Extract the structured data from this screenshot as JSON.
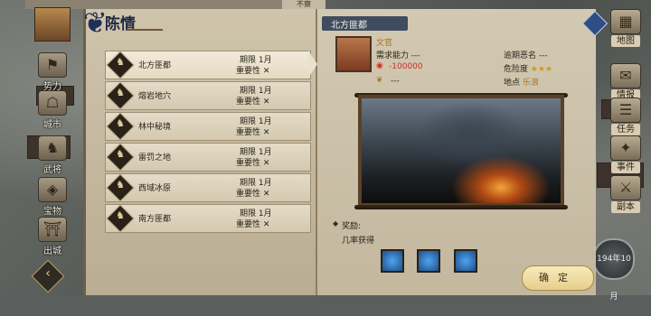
{
  "panel_title": "陈情",
  "top_label": "不察",
  "left_nav": [
    {
      "label": "势力",
      "icon": "faction-icon"
    },
    {
      "label": "城市",
      "icon": "city-icon"
    },
    {
      "label": "武将",
      "icon": "general-icon"
    },
    {
      "label": "宝物",
      "icon": "treasure-icon"
    },
    {
      "label": "出城",
      "icon": "exit-city-icon"
    }
  ],
  "right_nav": [
    {
      "label": "地图",
      "icon": "map-icon"
    },
    {
      "label": "情报",
      "icon": "intel-icon"
    },
    {
      "label": "任务",
      "icon": "quest-icon"
    },
    {
      "label": "事件",
      "icon": "event-icon"
    },
    {
      "label": "副本",
      "icon": "dungeon-icon"
    }
  ],
  "list": [
    {
      "name": "北方匪都",
      "due": "期限 1月",
      "importance": "重要性",
      "mark": "✕"
    },
    {
      "name": "熔岩地穴",
      "due": "期限 1月",
      "importance": "重要性",
      "mark": "✕"
    },
    {
      "name": "林中秘境",
      "due": "期限 1月",
      "importance": "重要性",
      "mark": "✕"
    },
    {
      "name": "雷罚之地",
      "due": "期限 1月",
      "importance": "重要性",
      "mark": "✕"
    },
    {
      "name": "西域冰原",
      "due": "期限 1月",
      "importance": "重要性",
      "mark": "✕"
    },
    {
      "name": "南方匪都",
      "due": "期限 1月",
      "importance": "重要性",
      "mark": "✕"
    }
  ],
  "detail": {
    "title": "北方匪都",
    "role": "文官",
    "req_ability_label": "需求能力 ---",
    "cost": "-100000",
    "third_row": "---",
    "overdue_label": "逾期恶名 ---",
    "danger_label": "危险度",
    "danger_stars": "★★★",
    "location_label": "地点",
    "location_value": "乐浪",
    "reward_label": "奖励:",
    "reward_sub": "几率获得",
    "confirm": "确定"
  },
  "date_badge": "194年10月"
}
